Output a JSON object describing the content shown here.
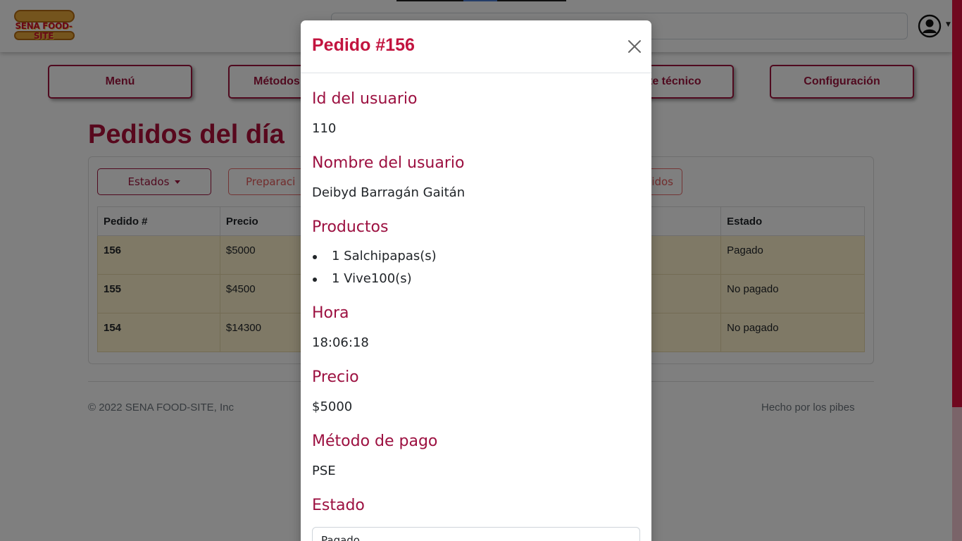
{
  "brand": {
    "logo_text": "SENA FOOD-SITE"
  },
  "nav": {
    "items": [
      {
        "label": "Menú"
      },
      {
        "label": "Métodos"
      },
      {
        "label": "te técnico"
      },
      {
        "label": "Configuración"
      }
    ]
  },
  "page": {
    "title": "Pedidos del día"
  },
  "filters": {
    "estados_label": "Estados",
    "preparacion_label": "Preparaci",
    "pedidos_label": "idos"
  },
  "table": {
    "headers": [
      "Pedido #",
      "Precio",
      "Estado"
    ],
    "rows": [
      {
        "id": "156",
        "precio": "$5000",
        "estado": "Pagado"
      },
      {
        "id": "155",
        "precio": "$4500",
        "estado": "No pagado"
      },
      {
        "id": "154",
        "precio": "$14300",
        "estado": "No pagado"
      }
    ]
  },
  "footer": {
    "copyright": "© 2022 SENA FOOD-SITE, Inc",
    "credits": "Hecho por los pibes"
  },
  "modal": {
    "title": "Pedido #156",
    "fields": {
      "user_id_label": "Id del usuario",
      "user_id_value": "110",
      "user_name_label": "Nombre del usuario",
      "user_name_value": "Deibyd Barragán Gaitán",
      "products_label": "Productos",
      "products": [
        "1 Salchipapas(s)",
        "1 Vive100(s)"
      ],
      "time_label": "Hora",
      "time_value": "18:06:18",
      "price_label": "Precio",
      "price_value": "$5000",
      "payment_label": "Método de pago",
      "payment_value": "PSE",
      "status_label": "Estado",
      "status_value": "Pagado"
    }
  },
  "colors": {
    "brand_primary": "#a0153e",
    "title_red": "#c2143f",
    "row_highlight": "#fff3cd",
    "scrollbar_thumb": "#e0103f"
  }
}
